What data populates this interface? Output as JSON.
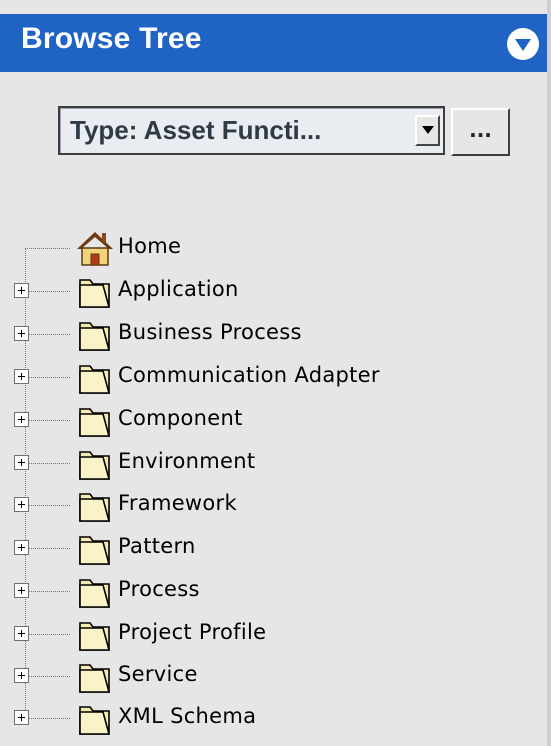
{
  "panel": {
    "title": "Browse Tree",
    "collapse_icon": "chevron-down-circle-icon",
    "accent_color": "#1f63c4"
  },
  "filter": {
    "selected": "Type: Asset Functi...",
    "browse_button_label": "..."
  },
  "tree": {
    "root": {
      "label": "Home",
      "icon": "home-icon"
    },
    "items": [
      {
        "label": "Application",
        "icon": "folder-icon"
      },
      {
        "label": "Business Process",
        "icon": "folder-icon"
      },
      {
        "label": "Communication Adapter",
        "icon": "folder-icon"
      },
      {
        "label": "Component",
        "icon": "folder-icon"
      },
      {
        "label": "Environment",
        "icon": "folder-icon"
      },
      {
        "label": "Framework",
        "icon": "folder-icon"
      },
      {
        "label": "Pattern",
        "icon": "folder-icon"
      },
      {
        "label": "Process",
        "icon": "folder-icon"
      },
      {
        "label": "Project Profile",
        "icon": "folder-icon"
      },
      {
        "label": "Service",
        "icon": "folder-icon"
      },
      {
        "label": "XML Schema",
        "icon": "folder-icon"
      }
    ]
  }
}
